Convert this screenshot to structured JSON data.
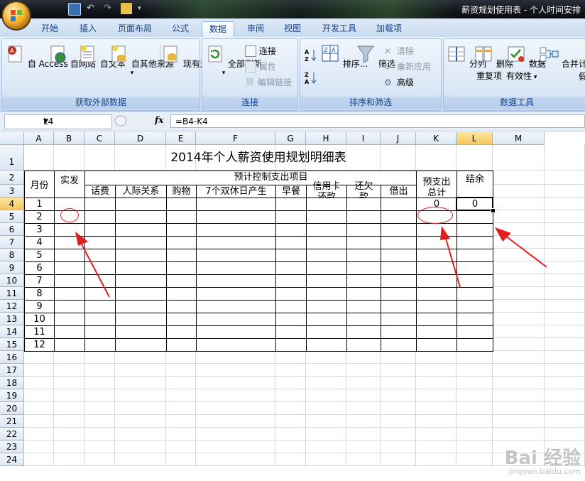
{
  "window": {
    "title": "薪资规划使用表 - 个人时间安排"
  },
  "ribbon_tabs": [
    "开始",
    "插入",
    "页面布局",
    "公式",
    "数据",
    "审阅",
    "视图",
    "开发工具",
    "加载项"
  ],
  "active_tab": "数据",
  "groups": {
    "external": {
      "label": "获取外部数据",
      "buttons": [
        "自 Access",
        "自网站",
        "自文本",
        "自其他来源",
        "现有连接"
      ]
    },
    "connections": {
      "label": "连接",
      "big": "全部刷新",
      "small": [
        "连接",
        "属性",
        "编辑链接"
      ]
    },
    "sort_filter": {
      "label": "排序和筛选",
      "sort": "排序...",
      "filter": "筛选",
      "small": [
        "清除",
        "重新应用",
        "高级"
      ]
    },
    "data_tools": {
      "label": "数据工具",
      "buttons": [
        "分列",
        "删除",
        "数据",
        "合并计算",
        "假"
      ],
      "sub": [
        "重复项",
        "有效性"
      ]
    }
  },
  "formula_bar": {
    "name_box": "L4",
    "fx": "fx",
    "formula": "=B4-K4"
  },
  "columns": [
    "A",
    "B",
    "C",
    "D",
    "E",
    "F",
    "G",
    "H",
    "I",
    "J",
    "K",
    "L",
    "M"
  ],
  "rows": [
    "1",
    "2",
    "3",
    "4",
    "5",
    "6",
    "7",
    "8",
    "9",
    "10",
    "11",
    "12",
    "13",
    "14",
    "15",
    "16",
    "17",
    "18",
    "19",
    "20",
    "21",
    "22",
    "23",
    "24"
  ],
  "sheet": {
    "title": "2014年个人薪资使用规划明细表",
    "h_month": "月份",
    "h_paid": "实发",
    "h_group": "预计控制支出项目",
    "h_items": [
      "话费",
      "人际关系",
      "购物",
      "7个双休日产生",
      "早餐",
      "信用卡还款",
      "还欠款",
      "借出",
      "预支出总计"
    ],
    "h_balance": "结余",
    "months": [
      "1",
      "2",
      "3",
      "4",
      "5",
      "6",
      "7",
      "8",
      "9",
      "10",
      "11",
      "12"
    ],
    "k4": "0",
    "l4": "0"
  },
  "watermark": {
    "text": "Bai 经验",
    "sub": "jingyan.baidu.com"
  },
  "colors": {
    "annotation": "#e02020",
    "selected_header": "#f6c75c"
  }
}
